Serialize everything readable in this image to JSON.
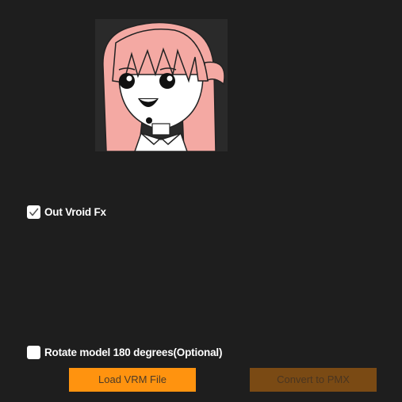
{
  "preview": {
    "icon": "avatar-thumbnail",
    "colors": {
      "background": "#2a2a2a",
      "hair": "#f4a9a3",
      "skin": "#ffffff",
      "outline": "#111111"
    }
  },
  "options": {
    "out_vroid_fx": {
      "label": "Out Vroid Fx",
      "checked": true
    },
    "rotate_model": {
      "label": "Rotate model 180 degrees(Optional)",
      "checked": false
    }
  },
  "buttons": {
    "load_label": "Load VRM File",
    "convert_label": "Convert to PMX",
    "convert_enabled": false
  },
  "colors": {
    "background": "#1e1e1e",
    "accent": "#ff930f",
    "accent_disabled": "#7a4a14"
  }
}
